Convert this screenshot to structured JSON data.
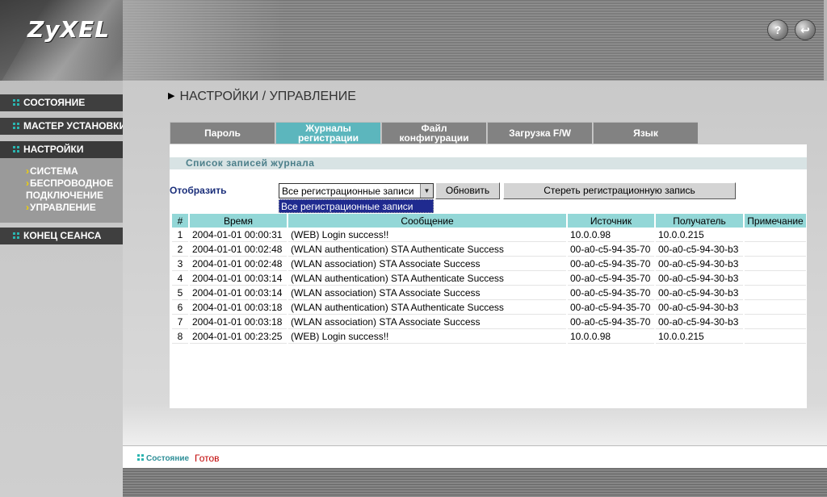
{
  "brand": {
    "logo": "ZyXEL"
  },
  "header_icons": [
    {
      "name": "help-icon",
      "glyph": "?"
    },
    {
      "name": "exit-icon",
      "glyph": "↩"
    }
  ],
  "sidebar": {
    "items": [
      {
        "label": "СОСТОЯНИЕ"
      },
      {
        "label": "МАСТЕР УСТАНОВКИ"
      },
      {
        "label": "НАСТРОЙКИ"
      },
      {
        "label": "КОНЕЦ СЕАНСА"
      }
    ],
    "submenu": [
      {
        "label": "СИСТЕМА"
      },
      {
        "label": "БЕСПРОВОДНОЕ"
      },
      {
        "label": "ПОДКЛЮЧЕНИЕ"
      },
      {
        "label": "УПРАВЛЕНИЕ"
      }
    ]
  },
  "page": {
    "title": "НАСТРОЙКИ / УПРАВЛЕНИЕ"
  },
  "tabs": [
    {
      "line1": "Пароль",
      "line2": ""
    },
    {
      "line1": "Журналы",
      "line2": "регистрации"
    },
    {
      "line1": "Файл",
      "line2": "конфигурации"
    },
    {
      "line1": "Загрузка F/W",
      "line2": ""
    },
    {
      "line1": "Язык",
      "line2": ""
    }
  ],
  "section": {
    "title": "Список записей журнала"
  },
  "filter": {
    "label": "Отобразить",
    "selected": "Все регистрационные записи",
    "open_option": "Все регистрационные записи",
    "refresh_label": "Обновить",
    "clear_label": "Стереть регистрационную запись"
  },
  "table": {
    "headers": [
      "#",
      "Время",
      "Сообщение",
      "Источник",
      "Получатель",
      "Примечание"
    ],
    "rows": [
      [
        "1",
        "2004-01-01 00:00:31",
        "(WEB) Login success!!",
        "10.0.0.98",
        "10.0.0.215",
        ""
      ],
      [
        "2",
        "2004-01-01 00:02:48",
        "(WLAN authentication) STA Authenticate Success",
        "00-a0-c5-94-35-70",
        "00-a0-c5-94-30-b3",
        ""
      ],
      [
        "3",
        "2004-01-01 00:02:48",
        "(WLAN association) STA Associate Success",
        "00-a0-c5-94-35-70",
        "00-a0-c5-94-30-b3",
        ""
      ],
      [
        "4",
        "2004-01-01 00:03:14",
        "(WLAN authentication) STA Authenticate Success",
        "00-a0-c5-94-35-70",
        "00-a0-c5-94-30-b3",
        ""
      ],
      [
        "5",
        "2004-01-01 00:03:14",
        "(WLAN association) STA Associate Success",
        "00-a0-c5-94-35-70",
        "00-a0-c5-94-30-b3",
        ""
      ],
      [
        "6",
        "2004-01-01 00:03:18",
        "(WLAN authentication) STA Authenticate Success",
        "00-a0-c5-94-35-70",
        "00-a0-c5-94-30-b3",
        ""
      ],
      [
        "7",
        "2004-01-01 00:03:18",
        "(WLAN association) STA Associate Success",
        "00-a0-c5-94-35-70",
        "00-a0-c5-94-30-b3",
        ""
      ],
      [
        "8",
        "2004-01-01 00:23:25",
        "(WEB) Login success!!",
        "10.0.0.98",
        "10.0.0.215",
        ""
      ]
    ]
  },
  "status": {
    "label": "Состояние",
    "value": "Готов"
  },
  "colors": {
    "accent": "#5cb6bd",
    "table_header": "#93d7d7",
    "status_value": "#c00000",
    "selection": "#1f2a8f"
  }
}
